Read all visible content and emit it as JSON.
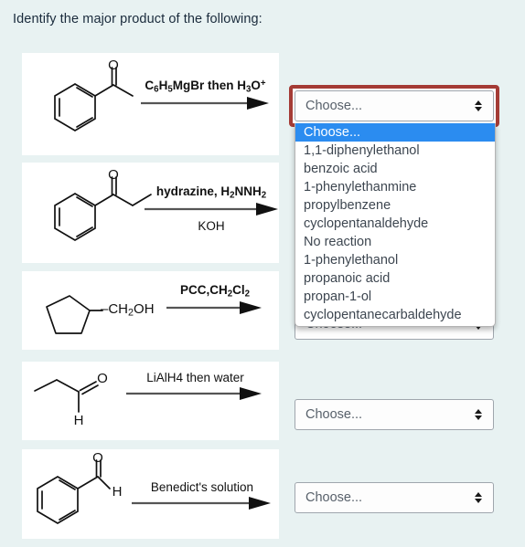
{
  "question": {
    "prompt": "Identify the major product of the following:"
  },
  "reactions": [
    {
      "id": "reaction-1",
      "substrate_name": "acetophenone",
      "reagents_top": "C6H5MgBr then H3O+",
      "reagents_bottom": ""
    },
    {
      "id": "reaction-2",
      "substrate_name": "propiophenone",
      "reagents_top": "hydrazine, H2NNH2",
      "reagents_bottom": "KOH"
    },
    {
      "id": "reaction-3",
      "substrate_name": "cyclopentylmethanol",
      "substrate_formula": "-CH2OH",
      "reagents_top": "PCC,CH2Cl2",
      "reagents_bottom": ""
    },
    {
      "id": "reaction-4",
      "substrate_name": "propanal",
      "substrate_atom_label": "H",
      "reagents_top": "LiAlH4 then water",
      "reagents_bottom": ""
    },
    {
      "id": "reaction-5",
      "substrate_name": "benzaldehyde",
      "substrate_atom_label": "H",
      "reagents_top": "Benedict's solution",
      "reagents_bottom": ""
    }
  ],
  "answer_selects": [
    {
      "id": "answer-select-1",
      "value": "Choose...",
      "focused": true,
      "open": true
    },
    {
      "id": "answer-select-2",
      "value": "Choose...",
      "focused": false,
      "open": false
    },
    {
      "id": "answer-select-3",
      "value": "Choose...",
      "focused": false,
      "open": false
    },
    {
      "id": "answer-select-4",
      "value": "Choose...",
      "focused": false,
      "open": false
    },
    {
      "id": "answer-select-5",
      "value": "Choose...",
      "focused": false,
      "open": false
    }
  ],
  "dropdown": {
    "open_for": "answer-select-1",
    "highlighted_index": 0,
    "options": [
      "Choose...",
      "1,1-diphenylethanol",
      "benzoic acid",
      "1-phenylethanmine",
      "propylbenzene",
      "cyclopentanaldehyde",
      "No reaction",
      "1-phenylethanol",
      "propanoic acid",
      "propan-1-ol",
      "cyclopentanecarbaldehyde"
    ]
  },
  "colors": {
    "page_background": "#e8f2f2",
    "panel_background": "#ffffff",
    "focus_ring": "#a43b35",
    "dropdown_highlight": "#2b8cf0",
    "select_border": "#9fa6ad",
    "text": "#1a2b3c"
  }
}
